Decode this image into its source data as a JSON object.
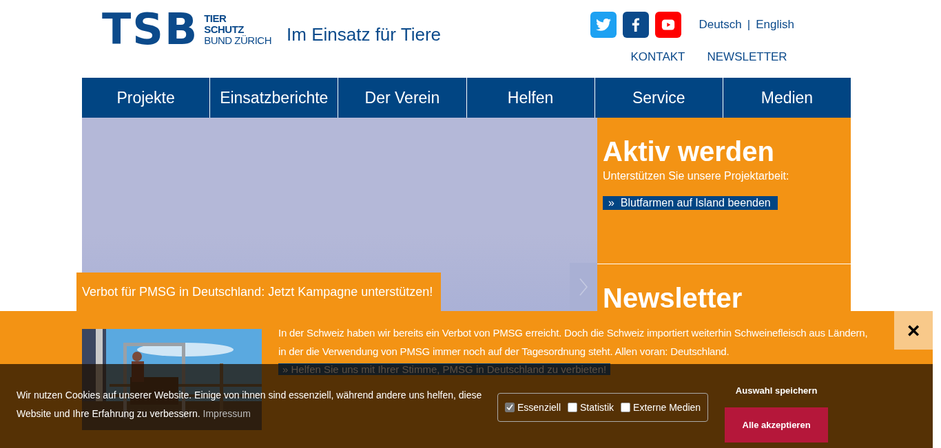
{
  "logo": {
    "letters": "TSB",
    "name_lines": [
      "TIER",
      "SCHUTZ",
      "BUND ZÜRICH"
    ],
    "tagline": "Im Einsatz für Tiere"
  },
  "social": [
    {
      "kind": "twitter"
    },
    {
      "kind": "facebook"
    },
    {
      "kind": "youtube"
    }
  ],
  "languages": [
    "Deutsch",
    "English"
  ],
  "language_separator": "|",
  "top_links": [
    "KONTAKT",
    "NEWSLETTER"
  ],
  "nav": [
    "Projekte",
    "Einsatzberichte",
    "Der Verein",
    "Helfen",
    "Service",
    "Medien"
  ],
  "slider": {
    "caption": "Verbot für PMSG in Deutschland: Jetzt Kampagne unterstützen!"
  },
  "sidebar": [
    {
      "kind": "cta",
      "title": "Aktiv werden",
      "text": "Unterstützen Sie unsere Projektarbeit:",
      "link": "»  Blutfarmen auf Island beenden"
    },
    {
      "kind": "teaser",
      "title": "Newsletter"
    }
  ],
  "popup": {
    "text": "In der Schweiz haben wir bereits ein Verbot von PMSG erreicht. Doch die Schweiz importiert weiterhin Schweinefleisch aus Ländern, in der die Verwendung von PMSG immer noch auf der Tagesordnung steht. Allen voran: Deutschland.",
    "link": "» Helfen Sie uns mit Ihrer Stimme, PMSG in Deutschland zu verbieten!",
    "close": "×"
  },
  "cookie_bar": {
    "text": "Wir nutzen Cookies auf unserer Website. Einige von ihnen sind essenziell, während andere uns helfen, diese Website und Ihre Erfahrung zu verbessern.",
    "link": "Impressum",
    "options": [
      {
        "label": "Essenziell",
        "checked": true,
        "disabled": true
      },
      {
        "label": "Statistik",
        "checked": false,
        "disabled": false
      },
      {
        "label": "Externe Medien",
        "checked": false,
        "disabled": false
      }
    ],
    "save": "Auswahl speichern",
    "accept": "Alle akzeptieren"
  }
}
